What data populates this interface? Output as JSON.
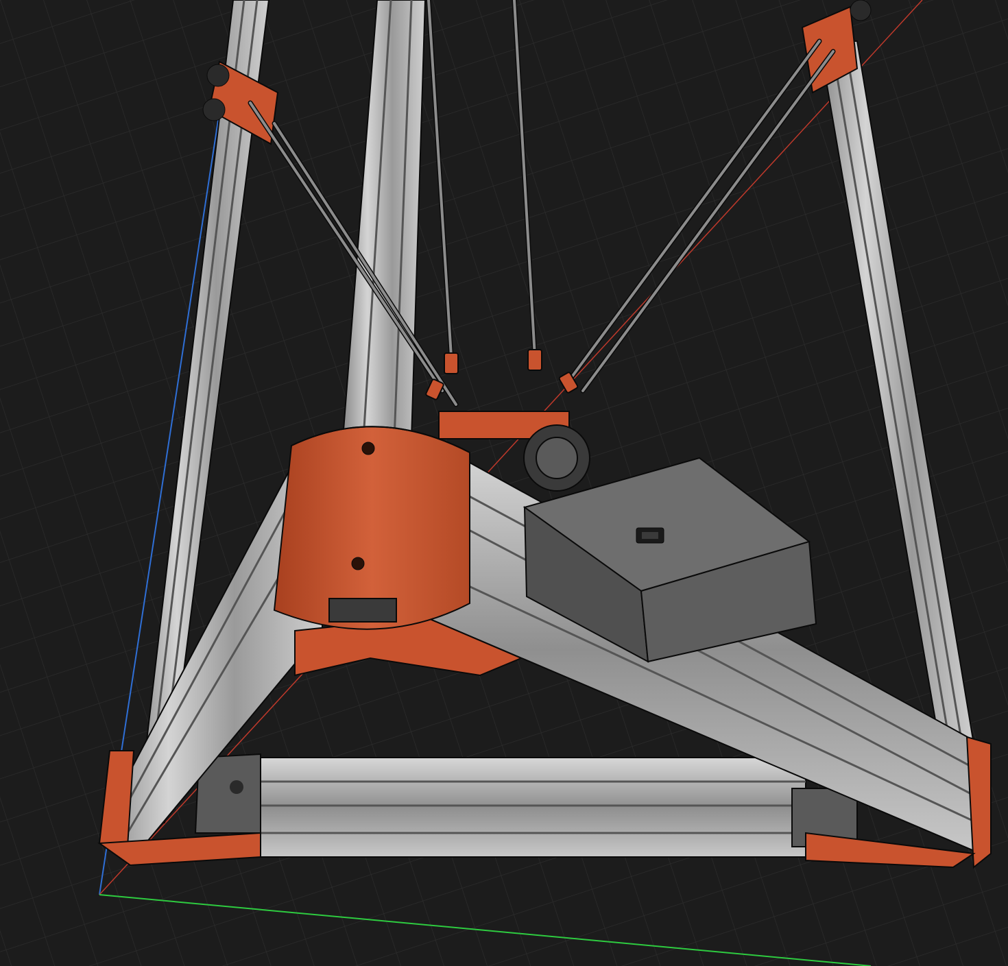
{
  "viewport": {
    "background": "#1c1c1c",
    "grid_color": "#2f2f2f",
    "axis_colors": {
      "x": "#c0392b",
      "y": "#2ecc40",
      "z": "#2f6fd6"
    }
  },
  "colors": {
    "extrusion": "#b8b8b8",
    "extrusion_dark": "#6a6a6a",
    "extrusion_light": "#dcdcdc",
    "printed_part": "#c9532e",
    "printed_part_dark": "#8e361c",
    "electronics_box": "#5a5a5a",
    "electronics_box_top": "#6e6e6e",
    "rod": "#8c8c8c",
    "outline": "#0a0a0a"
  },
  "icons": [
    "usb-port-icon"
  ]
}
